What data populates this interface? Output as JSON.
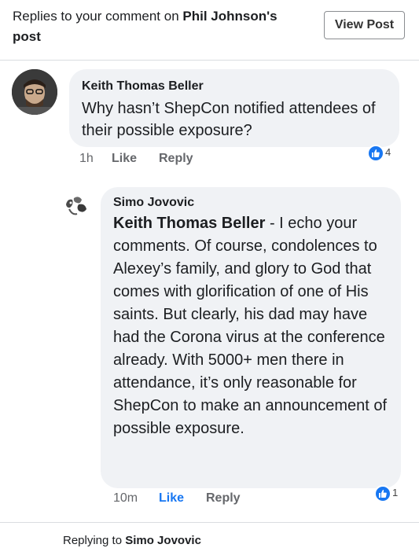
{
  "header": {
    "title_prefix": "Replies to your comment on",
    "title_name": "Phil Johnson's post",
    "view_post_label": "View Post"
  },
  "comment1": {
    "author": "Keith Thomas Beller",
    "text": "Why hasn’t ShepCon notified attendees of their possible exposure?",
    "time": "1h",
    "like_label": "Like",
    "reply_label": "Reply",
    "reaction_count": "4",
    "reaction_icon": "thumbs-up-icon"
  },
  "comment2": {
    "author": "Simo Jovovic",
    "mention": "Keith Thomas Beller",
    "text": " - I echo your comments. Of course, condolences to Alexey’s family, and glory to God that comes with glorification of one of His saints. But clearly, his dad may have had the Corona virus at the conference already. With 5000+ men there in attendance, it’s only reasonable for ShepCon to make an announcement of possible exposure.",
    "time": "10m",
    "like_label": "Like",
    "reply_label": "Reply",
    "reaction_count": "1",
    "reaction_icon": "thumbs-up-icon"
  },
  "footer": {
    "replying_prefix": "Replying to",
    "replying_name": "Simo Jovovic"
  },
  "colors": {
    "like_blue": "#1877f2",
    "bubble_bg": "#f0f2f5",
    "meta_gray": "#65676b"
  }
}
